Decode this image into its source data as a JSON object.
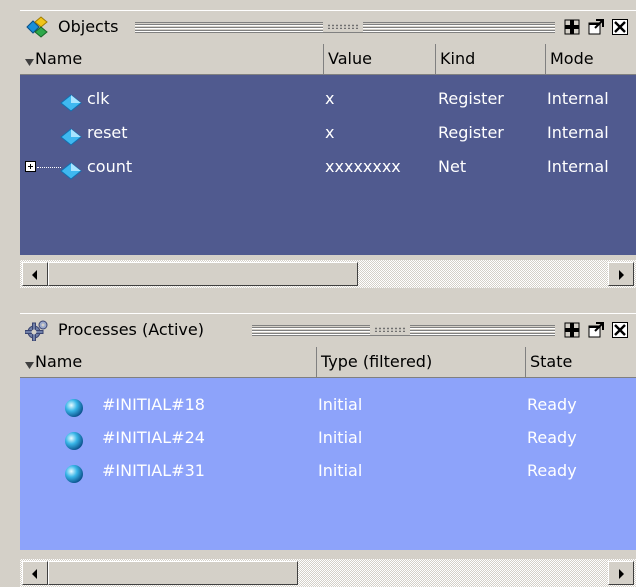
{
  "objects_pane": {
    "title": "Objects",
    "columns": [
      "Name",
      "Value",
      "Kind",
      "Mode"
    ],
    "rows": [
      {
        "name": "clk",
        "value": "x",
        "kind": "Register",
        "mode": "Internal",
        "expandable": false
      },
      {
        "name": "reset",
        "value": "x",
        "kind": "Register",
        "mode": "Internal",
        "expandable": false
      },
      {
        "name": "count",
        "value": "xxxxxxxx",
        "kind": "Net",
        "mode": "Internal",
        "expandable": true
      }
    ],
    "colors": {
      "list_bg": "#505a8f",
      "text": "#ffffff"
    }
  },
  "processes_pane": {
    "title": "Processes (Active)",
    "columns": [
      "Name",
      "Type (filtered)",
      "State"
    ],
    "rows": [
      {
        "name": "#INITIAL#18",
        "type": "Initial",
        "state": "Ready"
      },
      {
        "name": "#INITIAL#24",
        "type": "Initial",
        "state": "Ready"
      },
      {
        "name": "#INITIAL#31",
        "type": "Initial",
        "state": "Ready"
      }
    ],
    "colors": {
      "list_bg": "#8da3fa",
      "text": "#ffffff"
    }
  },
  "title_buttons": [
    "add-icon",
    "undock-icon",
    "close-icon"
  ],
  "icons": {
    "objects_title": "objects-cube-icon",
    "processes_title": "gear-icon",
    "object_row": "diamond-signal-icon",
    "process_row": "sphere-process-icon"
  }
}
